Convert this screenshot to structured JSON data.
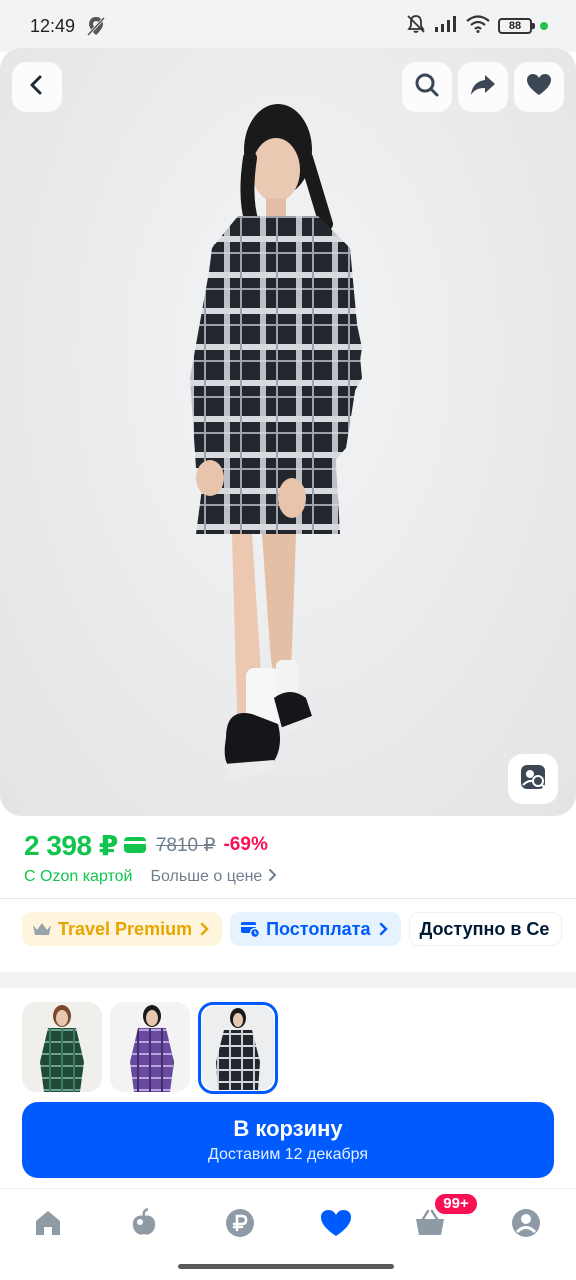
{
  "status_bar": {
    "time": "12:49",
    "battery": "88",
    "icons": [
      "location-off-icon",
      "mute-icon",
      "signal-icon",
      "wifi-icon",
      "battery-icon"
    ]
  },
  "hero": {
    "icons": {
      "back": "chevron-left-icon",
      "search": "search-icon",
      "share": "share-icon",
      "favorite": "heart-icon",
      "lens": "image-search-icon"
    }
  },
  "price": {
    "current": "2 398 ₽",
    "old": "7810 ₽",
    "discount": "-69%",
    "card_label": "С Ozon картой",
    "more_label": "Больше о цене"
  },
  "chips": [
    {
      "label": "Travel Premium",
      "icon": "crown-icon"
    },
    {
      "label": "Постоплата",
      "icon": "card-clock-icon"
    },
    {
      "label": "Доступно в Се"
    }
  ],
  "variants": [
    {
      "color": "green-plaid"
    },
    {
      "color": "purple-plaid"
    },
    {
      "color": "black-plaid",
      "selected": true
    }
  ],
  "cart_button": {
    "title": "В корзину",
    "subtitle": "Доставим 12 декабря"
  },
  "bottom_nav": {
    "items": [
      {
        "icon": "home-icon"
      },
      {
        "icon": "fresh-icon"
      },
      {
        "icon": "ruble-icon"
      },
      {
        "icon": "heart-icon",
        "active": true
      },
      {
        "icon": "basket-icon"
      },
      {
        "icon": "profile-icon"
      }
    ],
    "cart_badge": "99+"
  },
  "colors": {
    "accent": "#005bff",
    "price_green": "#10c44c",
    "discount_pink": "#f91155",
    "nav_icon": "#8e9aa6"
  }
}
